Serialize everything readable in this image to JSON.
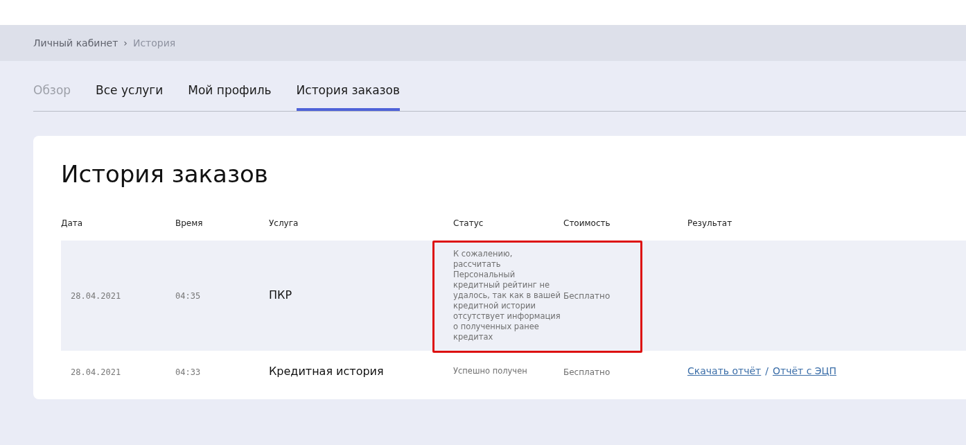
{
  "breadcrumbs": [
    {
      "label": "Личный кабинет",
      "current": false
    },
    {
      "label": "›",
      "current": false
    },
    {
      "label": "История",
      "current": true
    }
  ],
  "tabs": [
    {
      "label": "Обзор",
      "selected": false,
      "disabled": true
    },
    {
      "label": "Все услуги",
      "selected": false,
      "disabled": false
    },
    {
      "label": "Мой профиль",
      "selected": false,
      "disabled": false
    },
    {
      "label": "История заказов",
      "selected": true,
      "disabled": false
    }
  ],
  "card": {
    "title": "История заказов",
    "table": {
      "columns": [
        "Дата",
        "Время",
        "Услуга",
        "Статус",
        "Стоимость",
        "Результат"
      ],
      "rows": [
        {
          "date": "28.04.2021",
          "time": "04:35",
          "service": "ПКР",
          "status": "К сожалению, рассчитать Персональный кредитный рейтинг не удалось, так как в вашей кредитной истории отсутствует информация о полученных ранее кредитах",
          "cost": "Бесплатно",
          "result_links": [],
          "selected": true,
          "annotated": true
        },
        {
          "date": "28.04.2021",
          "time": "04:33",
          "service": "Кредитная история",
          "status": "Успешно получен",
          "cost": "Бесплатно",
          "result_links": [
            "Скачать отчёт",
            "/",
            "Отчёт с ЭЦП"
          ],
          "selected": false,
          "annotated": false
        }
      ]
    }
  }
}
